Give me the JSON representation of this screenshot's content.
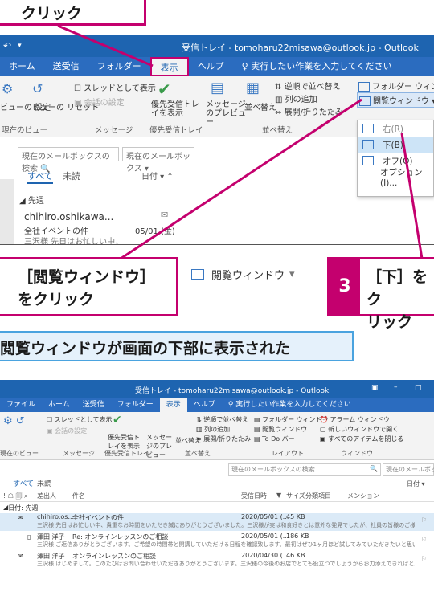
{
  "callouts": {
    "top": "クリック",
    "mid_line1": "［閲覧ウィンドウ］",
    "mid_line2": "をクリック",
    "right_num": "3",
    "right_line1": "［下］をク",
    "right_line2": "リック",
    "reading_button": "閲覧ウィンドウ",
    "banner": "閲覧ウィンドウが画面の下部に表示された"
  },
  "shot1": {
    "title": "受信トレイ - tomoharu22misawa@outlook.jp - Outlook",
    "tabs": [
      "ホーム",
      "送受信",
      "フォルダー",
      "表示",
      "ヘルプ"
    ],
    "tell_me": "実行したい作業を入力してください",
    "ribbon": {
      "view_change": "ビューの",
      "view_settings": "ビューの 設定",
      "view_reset": "ビューの リセット",
      "current_view": "現在のビュー",
      "thread_show": "スレッドとして表示",
      "conversation_settings": "会話の設定",
      "messages_group": "メッセージ",
      "focused": "優先受信トレイを表示",
      "focused_group": "優先受信トレイ",
      "preview": "メッセージのプレビュー",
      "arrange": "並べ替え",
      "reverse_sort": "逆順で並べ替え",
      "add_columns": "列の追加",
      "expand_collapse": "展開/折りたたみ",
      "arrange_group": "並べ替え",
      "folder_pane": "フォルダー ウィンドウ",
      "reading_pane": "閲覧ウィンドウ"
    },
    "dropdown": [
      "右(R)",
      "下(B)",
      "オフ(O)",
      "オプション(I)..."
    ],
    "search_placeholder": "現在のメールボックスの検索",
    "search_scope": "現在のメールボックス",
    "filter_all": "すべて",
    "filter_unread": "未読",
    "sort": "日付",
    "group": "先週",
    "mail": {
      "from": "chihiro.oshikawa...",
      "subject": "全社イベントの件",
      "date": "05/01 (金)",
      "preview": "三沢様 先日はお忙しい中、"
    }
  },
  "shot2": {
    "title": "受信トレイ - tomoharu22misawa@outlook.jp - Outlook",
    "tabs": [
      "ファイル",
      "ホーム",
      "送受信",
      "フォルダー",
      "表示",
      "ヘルプ"
    ],
    "tell_me": "実行したい作業を入力してください",
    "ribbon": {
      "thread": "スレッドとして表示",
      "conv": "会話の設定",
      "focus": "優先受信トレイを表示",
      "preview": "メッセージのプレビュー",
      "arrange": "並べ替え",
      "reverse": "逆順で並べ替え",
      "addcol": "列の追加",
      "expand": "展開/折りたたみ",
      "folderpane": "フォルダー ウィンドウ",
      "readingpane": "閲覧ウィンドウ",
      "todo": "To Do バー",
      "reminder": "アラーム ウィンドウ",
      "newwin": "新しいウィンドウで開く",
      "closeall": "すべてのアイテムを閉じる",
      "g_msg": "メッセージ",
      "g_focus": "優先受信トレイ",
      "g_arrange": "並べ替え",
      "g_layout": "レイアウト",
      "g_window": "ウィンドウ",
      "g_current": "現在のビュー"
    },
    "search_placeholder": "現在のメールボックスの検索",
    "search_scope": "現在のメールボックス",
    "filter_all": "すべて",
    "filter_unread": "未読",
    "sort": "日付",
    "headers": [
      "差出人",
      "件名",
      "受信日時",
      "サイズ",
      "分類項目",
      "メンション"
    ],
    "group": "日付: 先週",
    "rows": [
      {
        "from": "chihiro.os...",
        "subject": "全社イベントの件",
        "date": "2020/05/01 (...",
        "size": "45 KB",
        "preview": "三沢様 先日はお忙しい中、貴重なお時間をいただき誠にありがとうございました。三沢様が実は和食好きとは意外な発見でしたが、社員の皆様のご様子なども伺"
      },
      {
        "from": "澤田 洋子",
        "subject": "Re: オンラインレッスンのご相談",
        "date": "2020/05/01 (...",
        "size": "186 KB",
        "preview": "三沢様 ご返信ありがとうございます。ご希望の時間帯と開講していただける日程を確認致します。最初はぜひ1ヶ月ほど試してみていただきたいと思います。私のほうでもレッスンプランを"
      },
      {
        "from": "澤田 洋子",
        "subject": "オンラインレッスンのご相談",
        "date": "2020/04/30 (...",
        "size": "46 KB",
        "preview": "三沢様 はじめまして。このたびはお問い合わせいただきありがとうございます。三沢様の今後のお店でとても役立つでしょうからお力添えできればと思います。さっそく"
      }
    ]
  }
}
